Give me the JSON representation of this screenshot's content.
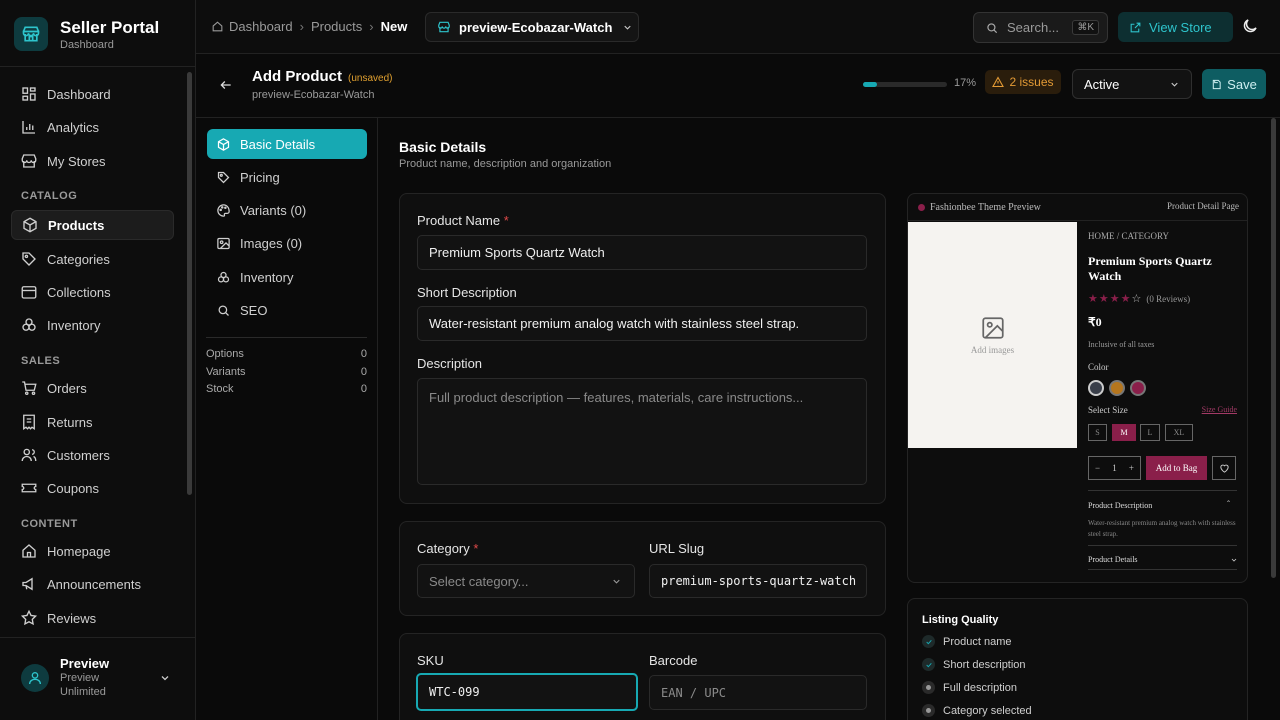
{
  "app": {
    "title": "Seller Portal",
    "subtitle": "Dashboard"
  },
  "sidebar": {
    "items": [
      {
        "label": "Dashboard",
        "icon": "layout-grid-icon"
      },
      {
        "label": "Analytics",
        "icon": "bar-chart-icon"
      },
      {
        "label": "My Stores",
        "icon": "store-icon"
      }
    ],
    "sections": [
      {
        "title": "CATALOG",
        "items": [
          {
            "label": "Products",
            "icon": "box-icon",
            "active": true
          },
          {
            "label": "Categories",
            "icon": "tag-icon"
          },
          {
            "label": "Collections",
            "icon": "folder-icon"
          },
          {
            "label": "Inventory",
            "icon": "boxes-icon"
          }
        ]
      },
      {
        "title": "SALES",
        "items": [
          {
            "label": "Orders",
            "icon": "cart-icon"
          },
          {
            "label": "Returns",
            "icon": "receipt-icon"
          },
          {
            "label": "Customers",
            "icon": "users-icon"
          },
          {
            "label": "Coupons",
            "icon": "ticket-icon"
          }
        ]
      },
      {
        "title": "CONTENT",
        "items": [
          {
            "label": "Homepage",
            "icon": "home-icon"
          },
          {
            "label": "Announcements",
            "icon": "megaphone-icon"
          },
          {
            "label": "Reviews",
            "icon": "star-icon"
          }
        ]
      }
    ],
    "user": {
      "name": "Preview",
      "plan": "Preview Unlimited"
    }
  },
  "topbar": {
    "breadcrumbs": [
      "Dashboard",
      "Products",
      "New"
    ],
    "store": "preview-Ecobazar-Watch",
    "search_placeholder": "Search...",
    "search_shortcut": "⌘K",
    "view_store": "View Store"
  },
  "header": {
    "title": "Add Product",
    "unsaved": "(unsaved)",
    "subtitle": "preview-Ecobazar-Watch",
    "progress_pct": "17%",
    "progress": 0.17,
    "issues": "2 issues",
    "status": "Active",
    "save": "Save"
  },
  "tabs": [
    {
      "label": "Basic Details",
      "icon": "box-icon",
      "active": true
    },
    {
      "label": "Pricing",
      "icon": "tag-icon"
    },
    {
      "label": "Variants (0)",
      "icon": "palette-icon"
    },
    {
      "label": "Images (0)",
      "icon": "image-icon"
    },
    {
      "label": "Inventory",
      "icon": "boxes-icon"
    },
    {
      "label": "SEO",
      "icon": "search-icon"
    }
  ],
  "stats": [
    {
      "label": "Options",
      "value": "0"
    },
    {
      "label": "Variants",
      "value": "0"
    },
    {
      "label": "Stock",
      "value": "0"
    }
  ],
  "form": {
    "section_title": "Basic Details",
    "section_sub": "Product name, description and organization",
    "name_label": "Product Name",
    "name_value": "Premium Sports Quartz Watch",
    "short_label": "Short Description",
    "short_value": "Water-resistant premium analog watch with stainless steel strap.",
    "desc_label": "Description",
    "desc_placeholder": "Full product description — features, materials, care instructions...",
    "category_label": "Category",
    "category_placeholder": "Select category...",
    "slug_label": "URL Slug",
    "slug_value": "premium-sports-quartz-watch",
    "sku_label": "SKU",
    "sku_value": "WTC-099",
    "barcode_label": "Barcode",
    "barcode_placeholder": "EAN / UPC"
  },
  "preview": {
    "theme": "Fashionbee Theme Preview",
    "page": "Product Detail Page",
    "add_images": "Add images",
    "breadcrumb": "HOME / CATEGORY",
    "title": "Premium Sports Quartz Watch",
    "reviews": "(0 Reviews)",
    "price": "₹0",
    "tax": "Inclusive of all taxes",
    "color_label": "Color",
    "colors": [
      "#3a3f4a",
      "#b5761e",
      "#8a1f4a"
    ],
    "size_label": "Select Size",
    "size_guide": "Size Guide",
    "sizes": [
      "S",
      "M",
      "L",
      "XL"
    ],
    "qty": "1",
    "add_to_bag": "Add to Bag",
    "desc_title": "Product Description",
    "desc_text": "Water-resistant premium analog watch with stainless steel strap.",
    "details_title": "Product Details",
    "accent": "#8a1f4a"
  },
  "quality": {
    "title": "Listing Quality",
    "items": [
      {
        "label": "Product name",
        "done": true
      },
      {
        "label": "Short description",
        "done": true
      },
      {
        "label": "Full description",
        "done": false
      },
      {
        "label": "Category selected",
        "done": false
      }
    ]
  },
  "colors": {
    "accent": "#17a9b3",
    "warning": "#e39a35"
  }
}
